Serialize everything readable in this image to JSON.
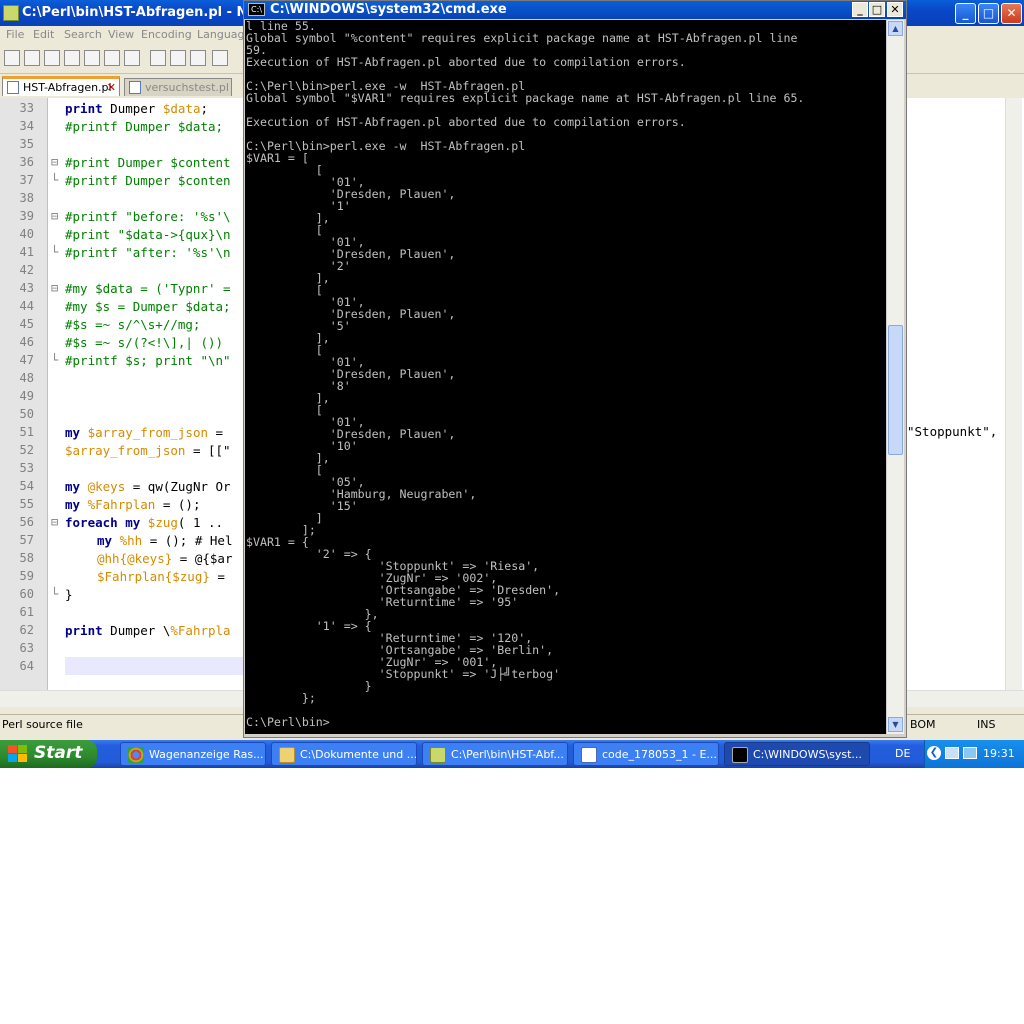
{
  "notepad": {
    "title": "C:\\Perl\\bin\\HST-Abfragen.pl - Note",
    "menu": [
      "File",
      "Edit",
      "Search",
      "View",
      "Encoding",
      "Languag"
    ],
    "tabs": [
      {
        "label": "HST-Abfragen.pl",
        "active": true
      },
      {
        "label": "versuchstest.pl",
        "active": false
      }
    ],
    "line_numbers": [
      "33",
      "34",
      "35",
      "36",
      "37",
      "38",
      "39",
      "40",
      "41",
      "42",
      "43",
      "44",
      "45",
      "46",
      "47",
      "48",
      "49",
      "50",
      "51",
      "52",
      "53",
      "54",
      "55",
      "56",
      "57",
      "58",
      "59",
      "60",
      "61",
      "62",
      "63",
      "64"
    ],
    "right_fragment": "\"Stoppunkt\",",
    "status": {
      "left": "Perl source file",
      "bom": "BOM",
      "ins": "INS"
    }
  },
  "code": {
    "l33_kw": "print",
    "l33_rest": " Dumper ",
    "l33_var": "$data",
    "l34": "#printf Dumper $data;",
    "l36": "#print Dumper $content",
    "l37": "#printf Dumper $conten",
    "l39": "#printf \"before: '%s'\\",
    "l40": "#print \"$data->{qux}\\n",
    "l41": "#printf \"after: '%s'\\n",
    "l43": "#my $data = ('Typnr' =",
    "l44": "#my $s = Dumper $data;",
    "l45": "#$s =~ s/^\\s+//mg;",
    "l46": "#$s =~ s/(?<!\\],| ())",
    "l47": "#printf $s; print \"\\n\"",
    "l51_kw": "my",
    "l51_var": " $array_from_json",
    "l51_rest": " =",
    "l52_var": "$array_from_json",
    "l52_rest": " = [[\"",
    "l54_kw": "my",
    "l54_var": " @keys",
    "l54_rest": " = qw(ZugNr Or",
    "l55_kw": "my",
    "l55_var": " %Fahrplan",
    "l55_rest": " = ();",
    "l56_kw": "foreach my",
    "l56_var": " $zug",
    "l56_rest": "( 1 ..",
    "l57_kw": "my",
    "l57_var": " %hh",
    "l57_rest": " = (); # Hel",
    "l58_var": "@hh{@keys}",
    "l58_rest": " = @{$ar",
    "l59_var": "$Fahrplan{$zug}",
    "l59_rest": " =",
    "l60": "}",
    "l62_kw": "print",
    "l62_rest": " Dumper \\",
    "l62_var": "%Fahrpla"
  },
  "cmd": {
    "title": "C:\\WINDOWS\\system32\\cmd.exe",
    "output": "l line 55.\nGlobal symbol \"%content\" requires explicit package name at HST-Abfragen.pl line\n59.\nExecution of HST-Abfragen.pl aborted due to compilation errors.\n\nC:\\Perl\\bin>perl.exe -w  HST-Abfragen.pl\nGlobal symbol \"$VAR1\" requires explicit package name at HST-Abfragen.pl line 65.\n\nExecution of HST-Abfragen.pl aborted due to compilation errors.\n\nC:\\Perl\\bin>perl.exe -w  HST-Abfragen.pl\n$VAR1 = [\n          [\n            '01',\n            'Dresden, Plauen',\n            '1'\n          ],\n          [\n            '01',\n            'Dresden, Plauen',\n            '2'\n          ],\n          [\n            '01',\n            'Dresden, Plauen',\n            '5'\n          ],\n          [\n            '01',\n            'Dresden, Plauen',\n            '8'\n          ],\n          [\n            '01',\n            'Dresden, Plauen',\n            '10'\n          ],\n          [\n            '05',\n            'Hamburg, Neugraben',\n            '15'\n          ]\n        ];\n$VAR1 = {\n          '2' => {\n                   'Stoppunkt' => 'Riesa',\n                   'ZugNr' => '002',\n                   'Ortsangabe' => 'Dresden',\n                   'Returntime' => '95'\n                 },\n          '1' => {\n                   'Returntime' => '120',\n                   'Ortsangabe' => 'Berlin',\n                   'ZugNr' => '001',\n                   'Stoppunkt' => 'J├╝terbog'\n                 }\n        };\n\nC:\\Perl\\bin>"
  },
  "taskbar": {
    "start": "Start",
    "tasks": [
      {
        "label": "Wagenanzeige Ras...",
        "icon": "chrome-icon"
      },
      {
        "label": "C:\\Dokumente und ...",
        "icon": "folder-icon"
      },
      {
        "label": "C:\\Perl\\bin\\HST-Abf...",
        "icon": "notepad-icon"
      },
      {
        "label": "code_178053_1 - E...",
        "icon": "editor-icon"
      },
      {
        "label": "C:\\WINDOWS\\syst...",
        "icon": "cmd-icon"
      }
    ],
    "lang": "DE",
    "clock": "19:31"
  }
}
